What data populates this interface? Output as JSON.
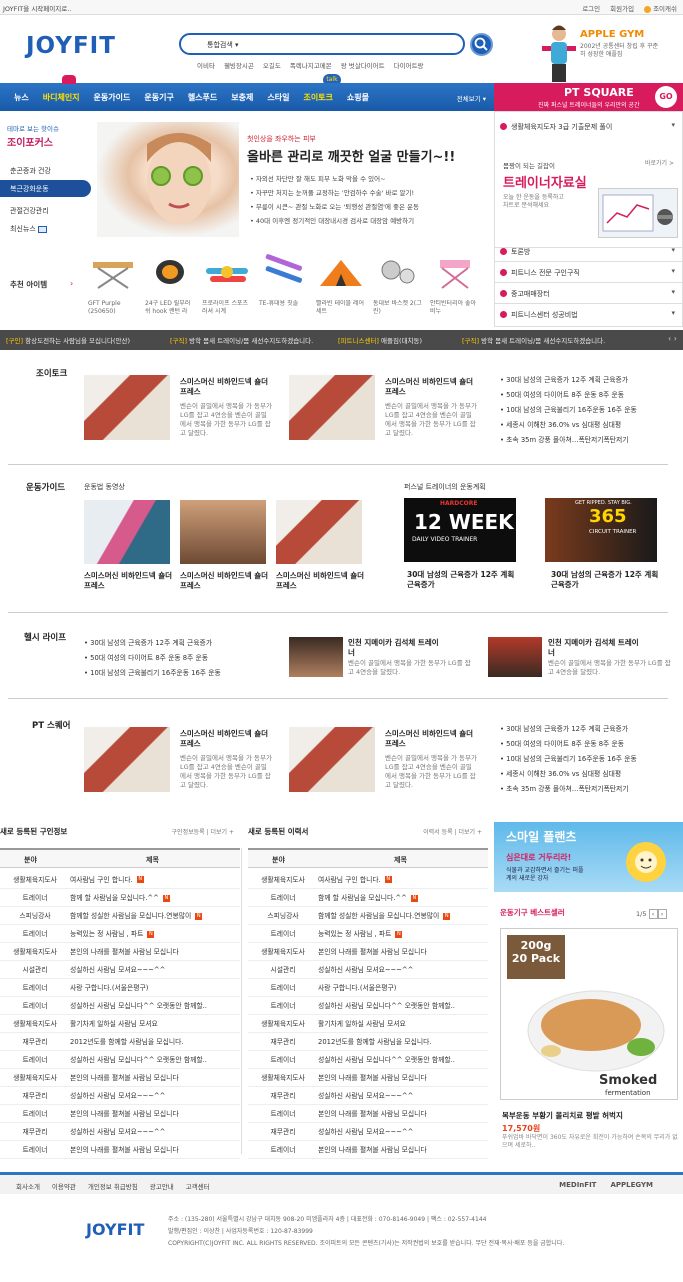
{
  "topbar": {
    "left": "JOYFIT을 시작페이지로..",
    "right": [
      "로그인",
      "회원가입",
      "조이캐쉬"
    ]
  },
  "header": {
    "logo": "JOYFIT",
    "search": {
      "category": "통합검색"
    },
    "hot_keywords": [
      "이비타",
      "웰빙장시곤",
      "오길도",
      "폭렉나지고메몬",
      "왕 벗살다이어트",
      "다이어트랑"
    ],
    "ad": {
      "title": "APPLE GYM",
      "sub": "2002년 공통센터 창립 후 꾸준히 성장한 애플짐"
    }
  },
  "nav": {
    "items": [
      "뉴스",
      "바디체인지",
      "운동가이드",
      "운동기구",
      "헬스푸드",
      "보충제",
      "스타일",
      "조이토크",
      "쇼핑몰"
    ],
    "talk_badge": "talk",
    "all_label": "전체보기 ▾"
  },
  "pt_square": {
    "title": "PT SQUARE",
    "sub": "진짜 퍼스널 트레이너들의 우리만의 공간",
    "go": "GO"
  },
  "left_menu": {
    "heading_small": "테마로 보는 핫이슈",
    "heading": "조이포커스",
    "items": [
      "춘곤증과 건강",
      "복근강화운동",
      "관절건강관리",
      "최신뉴스"
    ]
  },
  "hero": {
    "sub": "첫인상을 좌우하는 피부",
    "title": "올바른 관리로 깨끗한 얼굴 만들기~!!",
    "points": [
      "자외선 차단만 잘 해도 피부 노화 막을 수 있어~",
      "자꾸만 처지는 눈꺼풀 교정하는 '안검하수 수술' 바로 알기!",
      "무릎이 시큰~ 관절 노화로 오는 '퇴행성 관절염'에 좋은 운동",
      "40대 이후엔 정기적인 대장내시경 검사로 대장암 예방하기"
    ]
  },
  "recommend": {
    "label": "추천 아이템",
    "products": [
      "GFT Purple (250650)",
      "24구 LED 릴부러쉬 hook 랜턴 라",
      "프로라이프 스포츠 러셔 시계",
      "TE-휴대용 칫솔",
      "빨라빈 테이블 레어 세트",
      "통대보 바스켓 2(그린)",
      "안티빈터리아 좋아비누"
    ]
  },
  "right_box": {
    "row1": "생활체육지도자 3급 기출문제 풀이",
    "trainer": {
      "pre": "몸짱이 되는 길잡이",
      "title": "트레이너자료실",
      "desc": "오늘 한 운동을 등록하고 차트로 분석해세요",
      "more": "바로가기 >"
    },
    "rows": [
      "토론방",
      "피트니스 전문 구인구직",
      "중고매매장터",
      "피트니스센터 성공비법"
    ]
  },
  "ticker": [
    {
      "tag": "[구인]",
      "text": "항상도전하는 사람님을 모십니다(안산)"
    },
    {
      "tag": "[구직]",
      "text": "방학 몸새 트레이닝/몸 새선수지도하겠습니다."
    },
    {
      "tag": "[피트니스센터]",
      "text": "애플짐(대치동)"
    },
    {
      "tag": "[구직]",
      "text": "방학 몸새 트레이닝/몸 새선수지도하겠습니다."
    }
  ],
  "sec_talk": {
    "title": "조이토크",
    "cards": [
      {
        "title": "스미스머신 비하인드넥 숄더 프레스",
        "desc": "벤슨이 골밀에서 맹목을 가 동부가 LG를 잡고 4연승을 벤슨이 골밀에서 맹목을 가한 동부가 LG를 잡고 달렸다."
      },
      {
        "title": "스미스머신 비하인드넥 숄더 프레스",
        "desc": "벤슨이 골밀에서 맹목을 가 동부가 LG를 잡고 4연승을 벤슨이 골밀에서 맹목을 가한 동부가 LG를 잡고 달렸다."
      }
    ],
    "list": [
      "30대 남성의 근육증가 12주 계획 근육증가",
      "50대 여성의 다이어트 8주 운동 8주 운동",
      "10대 남성의 근육불리기 16주운동 16주 운동",
      "세종시 이해찬 36.0% vs 심대평 심대평",
      "초속 35m 강풍 몰아쳐…폭탄저기폭탄저기"
    ]
  },
  "sec_guide": {
    "title": "운동가이드",
    "video_label": "운동법 동영상",
    "videos": [
      "스미스머신 비하인드넥 숄더 프레스",
      "스미스머신 비하인드넥 숄더 프레스",
      "스미스머신 비하인드넥 숄더 프레스"
    ],
    "trainer_label": "퍼스널 트레이너의 운동계획",
    "plans": [
      {
        "img_top": "HARDCORE",
        "img_main": "12 WEEK",
        "img_sub": "DAILY VIDEO TRAINER",
        "title": "30대 남성의 근육증가 12주 계획 근육증가"
      },
      {
        "img_top": "GET RIPPED. STAY BIG.",
        "img_main": "365",
        "img_sub": "CIRCUIT TRAINER",
        "title": "30대 남성의 근육증가 12주 계획 근육증가"
      }
    ]
  },
  "sec_life": {
    "title": "헬시 라이프",
    "list": [
      "30대 남성의 근육증가 12주 계획 근육증가",
      "50대 여성의 다이어트 8주 운동 8주 운동",
      "10대 남성의 근육불리기 16주운동 16주 운동"
    ],
    "cards": [
      {
        "title": "인천 지메이카 김석체 트레이너",
        "desc": "벤슨이 골밀에서 맹목을 가한 동부가 LG를 잡고 4연승을 달렸다."
      },
      {
        "title": "인천 지메이카 김석체 트레이너",
        "desc": "벤슨이 골밀에서 맹목을 가한 동부가 LG를 잡고 4연승을 달렸다."
      }
    ]
  },
  "sec_pt": {
    "title": "PT 스퀘어",
    "cards": [
      {
        "title": "스미스머신 비하인드넥 숄더 프레스",
        "desc": "벤슨이 골밀에서 맹목을 가 동부가 LG를 잡고 4연승을 벤슨이 골밀에서 맹목을 가한 동부가 LG를 잡고 달렸다."
      },
      {
        "title": "스미스머신 비하인드넥 숄더 프레스",
        "desc": "벤슨이 골밀에서 맹목을 가 동부가 LG를 잡고 4연승을 벤슨이 골밀에서 맹목을 가한 동부가 LG를 잡고 달렸다."
      }
    ],
    "list": [
      "30대 남성의 근육증가 12주 계획 근육증가",
      "50대 여성의 다이어트 8주 운동 8주 운동",
      "10대 남성의 근육불리기 16주운동 16주 운동",
      "세종시 이해찬 36.0% vs 심대평 심대평",
      "초속 35m 강풍 몰아쳐…폭탄저기폭탄저기"
    ]
  },
  "board_jobs": {
    "title": "새로 등록된 구인정보",
    "links": [
      "구인정보등록",
      "더보기 +"
    ],
    "columns": [
      "분야",
      "제목"
    ],
    "rows": [
      [
        "생활체육지도사",
        "여사람님 구인 합니다.",
        true
      ],
      [
        "트레이너",
        "함께 할 사람님을 모십니다.^^",
        true
      ],
      [
        "스피닝강사",
        "함께할 성실한 사람님을 모십니다.연봉많이",
        true
      ],
      [
        "트레이너",
        "능력있는 정 사람님 , 파트",
        true
      ],
      [
        "생활체육지도사",
        "본인의 나래를 펼쳐볼 사람님 모십니다",
        false
      ],
      [
        "시설관리",
        "성실하신 사람님 모셔요~~~^^",
        false
      ],
      [
        "트레이너",
        "사랑 구합니다.(서울은평구)",
        false
      ],
      [
        "트레이너",
        "성실하신 사람님 모십니다^^ 오랫동안 함께할..",
        false
      ],
      [
        "생활체육지도사",
        "활기차게 일하실 사람님 모셔요",
        false
      ],
      [
        "재무관리",
        "2012년도를 함께할 사람님을 모십니다.",
        false
      ],
      [
        "트레이너",
        "성실하신 사람님 모십니다^^ 오랫동안 함께할..",
        false
      ],
      [
        "생활체육지도사",
        "본인의 나래를 펼쳐볼 사람님 모십니다",
        false
      ],
      [
        "재무관리",
        "성실하신 사람님 모셔요~~~^^",
        false
      ],
      [
        "트레이너",
        "본인의 나래를 펼쳐볼 사람님 모십니다",
        false
      ],
      [
        "재무관리",
        "성실하신 사람님 모셔요~~~^^",
        false
      ],
      [
        "트레이너",
        "본인의 나래를 펼쳐볼 사람님 모십니다",
        false
      ]
    ]
  },
  "board_resumes": {
    "title": "새로 등록된 이력서",
    "links": [
      "이력서 등록",
      "더보기 +"
    ],
    "columns": [
      "분야",
      "제목"
    ],
    "rows": [
      [
        "생활체육지도사",
        "여사람님 구인 합니다.",
        true
      ],
      [
        "트레이너",
        "함께 할 사람님을 모십니다.^^",
        true
      ],
      [
        "스피닝강사",
        "함께할 성실한 사람님을 모십니다.연봉많이",
        true
      ],
      [
        "트레이너",
        "능력있는 정 사람님 , 파트",
        true
      ],
      [
        "생활체육지도사",
        "본인의 나래를 펼쳐볼 사람님 모십니다",
        false
      ],
      [
        "시설관리",
        "성실하신 사람님 모셔요~~~^^",
        false
      ],
      [
        "트레이너",
        "사랑 구합니다.(서울은평구)",
        false
      ],
      [
        "트레이너",
        "성실하신 사람님 모십니다^^ 오랫동안 함께할..",
        false
      ],
      [
        "생활체육지도사",
        "활기차게 일하실 사람님 모셔요",
        false
      ],
      [
        "재무관리",
        "2012년도를 함께할 사람님을 모십니다.",
        false
      ],
      [
        "트레이너",
        "성실하신 사람님 모십니다^^ 오랫동안 함께할..",
        false
      ],
      [
        "생활체육지도사",
        "본인의 나래를 펼쳐볼 사람님 모십니다",
        false
      ],
      [
        "재무관리",
        "성실하신 사람님 모셔요~~~^^",
        false
      ],
      [
        "트레이너",
        "본인의 나래를 펼쳐볼 사람님 모십니다",
        false
      ],
      [
        "재무관리",
        "성실하신 사람님 모셔요~~~^^",
        false
      ],
      [
        "트레이너",
        "본인의 나래를 펼쳐볼 사람님 모십니다",
        false
      ]
    ]
  },
  "smile": {
    "title": "스마일 플랜츠",
    "sub": "심은대로 거두리라!",
    "desc": "식물과 교감하면서 즐기는 퍼플계의 새로운 강자"
  },
  "best": {
    "title": "운동기구 베스트셀러",
    "page": "1/5",
    "img_badge1": "200g",
    "img_badge2": "20 Pack",
    "img_brand1": "Smoked",
    "img_brand2": "fermentation",
    "name": "복부운동 부황기 몰리치료 평발 허벅지",
    "price": "17,570원",
    "desc": "푸쉬업바 바닥면이 360도 자유로운 회전이 가능하여 손목의 무리가 없으며 세로하.."
  },
  "footer": {
    "links": [
      "회사소개",
      "이용약관",
      "개인정보 취급방침",
      "광고안내",
      "고객센터"
    ],
    "partners": [
      "MEDInFIT",
      "APPLEGYM"
    ],
    "logo": "JOYFIT",
    "info": [
      "주소 : (135-280) 서울특별시 강남구 대치동 908-20 미엠플라자 4층  |  대표전화 : 070-8146-9049  |  팩스 : 02-557-4144",
      "발행/편집인 : 이상찬  |  사업자등록번호 : 120-87-83999",
      "COPYRIGHT(C)JOYFIT INC. ALL RIGHTS RESERVED.  조이피트의 모든 콘텐츠(기사)는 저작권법의 보호를 받습니다. 무단 전재·복사·배포 등을 금합니다."
    ]
  },
  "colors": {
    "brand_blue": "#1f5fb5",
    "accent_pink": "#d81b5c",
    "ticker_bg": "#4a4a4a"
  }
}
